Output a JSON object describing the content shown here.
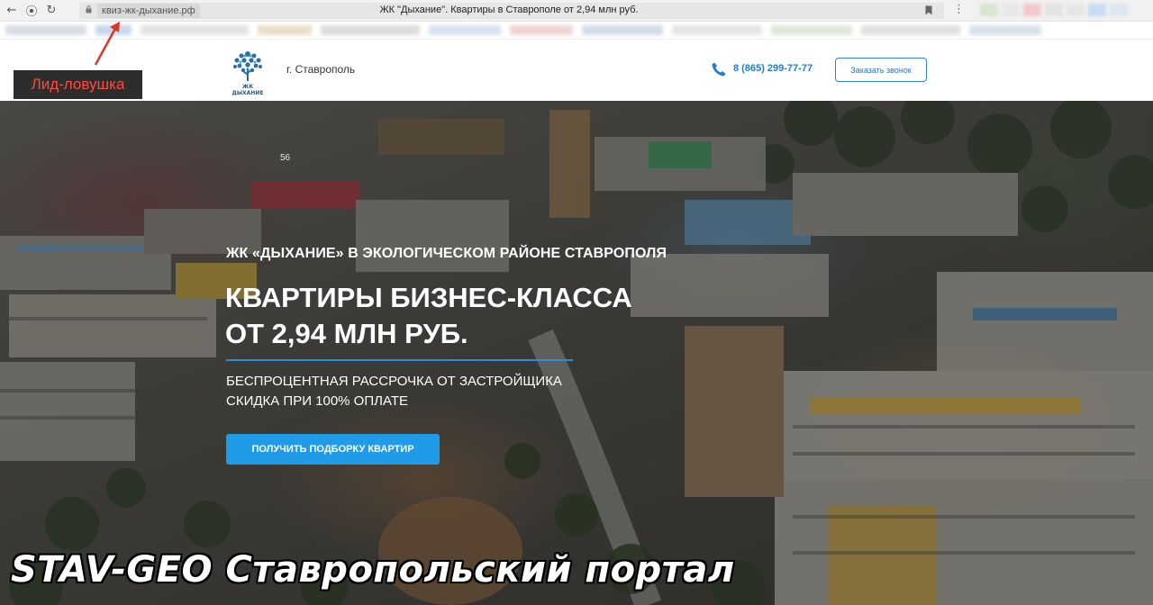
{
  "browser": {
    "url": "квиз-жк-дыхание.рф",
    "tab_title": "ЖК \"Дыхание\". Квартиры в Ставрополе от 2,94 млн руб.",
    "back_icon": "←",
    "reader_icon": "⦿",
    "reload_icon": "↻",
    "menu_icon": "⋮"
  },
  "header": {
    "logo_caption_line1": "ЖК",
    "logo_caption_line2": "ДЫХАНИЕ",
    "city": "г. Ставрополь",
    "phone": "8 (865) 299-77-77",
    "call_button": "Заказать звонок",
    "accent_color": "#1f7bd6"
  },
  "hero": {
    "map_label": "56",
    "subtitle": "ЖК «ДЫХАНИЕ» В ЭКОЛОГИЧЕСКОМ РАЙОНЕ СТАВРОПОЛЯ",
    "title_line1": "КВАРТИРЫ БИЗНЕС-КЛАССА",
    "title_line2": "ОТ 2,94 МЛН РУБ.",
    "offer_line1": "БЕСПРОЦЕНТНАЯ РАССРОЧКА ОТ ЗАСТРОЙЩИКА",
    "offer_line2": "СКИДКА ПРИ 100% ОПЛАТЕ",
    "cta_button": "ПОЛУЧИТЬ ПОДБОРКУ КВАРТИР",
    "cta_color": "#1f9be8"
  },
  "annotation": {
    "trap_label": "Лид-ловушка",
    "watermark": "STAV-GEO Ставропольский портал"
  }
}
